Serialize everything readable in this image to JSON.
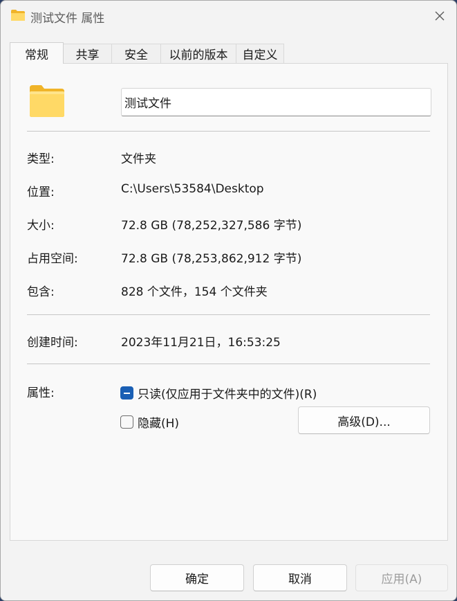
{
  "window": {
    "title": "测试文件 属性",
    "icon": "folder-icon",
    "close_icon": "close-icon"
  },
  "tabs": [
    {
      "label": "常规",
      "active": true
    },
    {
      "label": "共享",
      "active": false
    },
    {
      "label": "安全",
      "active": false
    },
    {
      "label": "以前的版本",
      "active": false
    },
    {
      "label": "自定义",
      "active": false
    }
  ],
  "general": {
    "name": "测试文件",
    "rows": [
      {
        "label": "类型:",
        "value": "文件夹"
      },
      {
        "label": "位置:",
        "value": "C:\\Users\\53584\\Desktop"
      },
      {
        "label": "大小:",
        "value": "72.8 GB (78,252,327,586 字节)"
      },
      {
        "label": "占用空间:",
        "value": "72.8 GB (78,253,862,912 字节)"
      },
      {
        "label": "包含:",
        "value": "828 个文件，154 个文件夹"
      }
    ],
    "created": {
      "label": "创建时间:",
      "value": "2023年11月21日，16:53:25"
    },
    "attributes": {
      "label": "属性:",
      "readonly": {
        "label": "只读(仅应用于文件夹中的文件)(R)",
        "state": "indeterminate"
      },
      "hidden": {
        "label": "隐藏(H)",
        "state": "unchecked"
      },
      "advanced_button": "高级(D)..."
    }
  },
  "footer": {
    "ok": "确定",
    "cancel": "取消",
    "apply": "应用(A)",
    "apply_enabled": false
  },
  "colors": {
    "accent": "#1a5fb4",
    "folder_light": "#ffd966",
    "folder_dark": "#f0b429"
  }
}
